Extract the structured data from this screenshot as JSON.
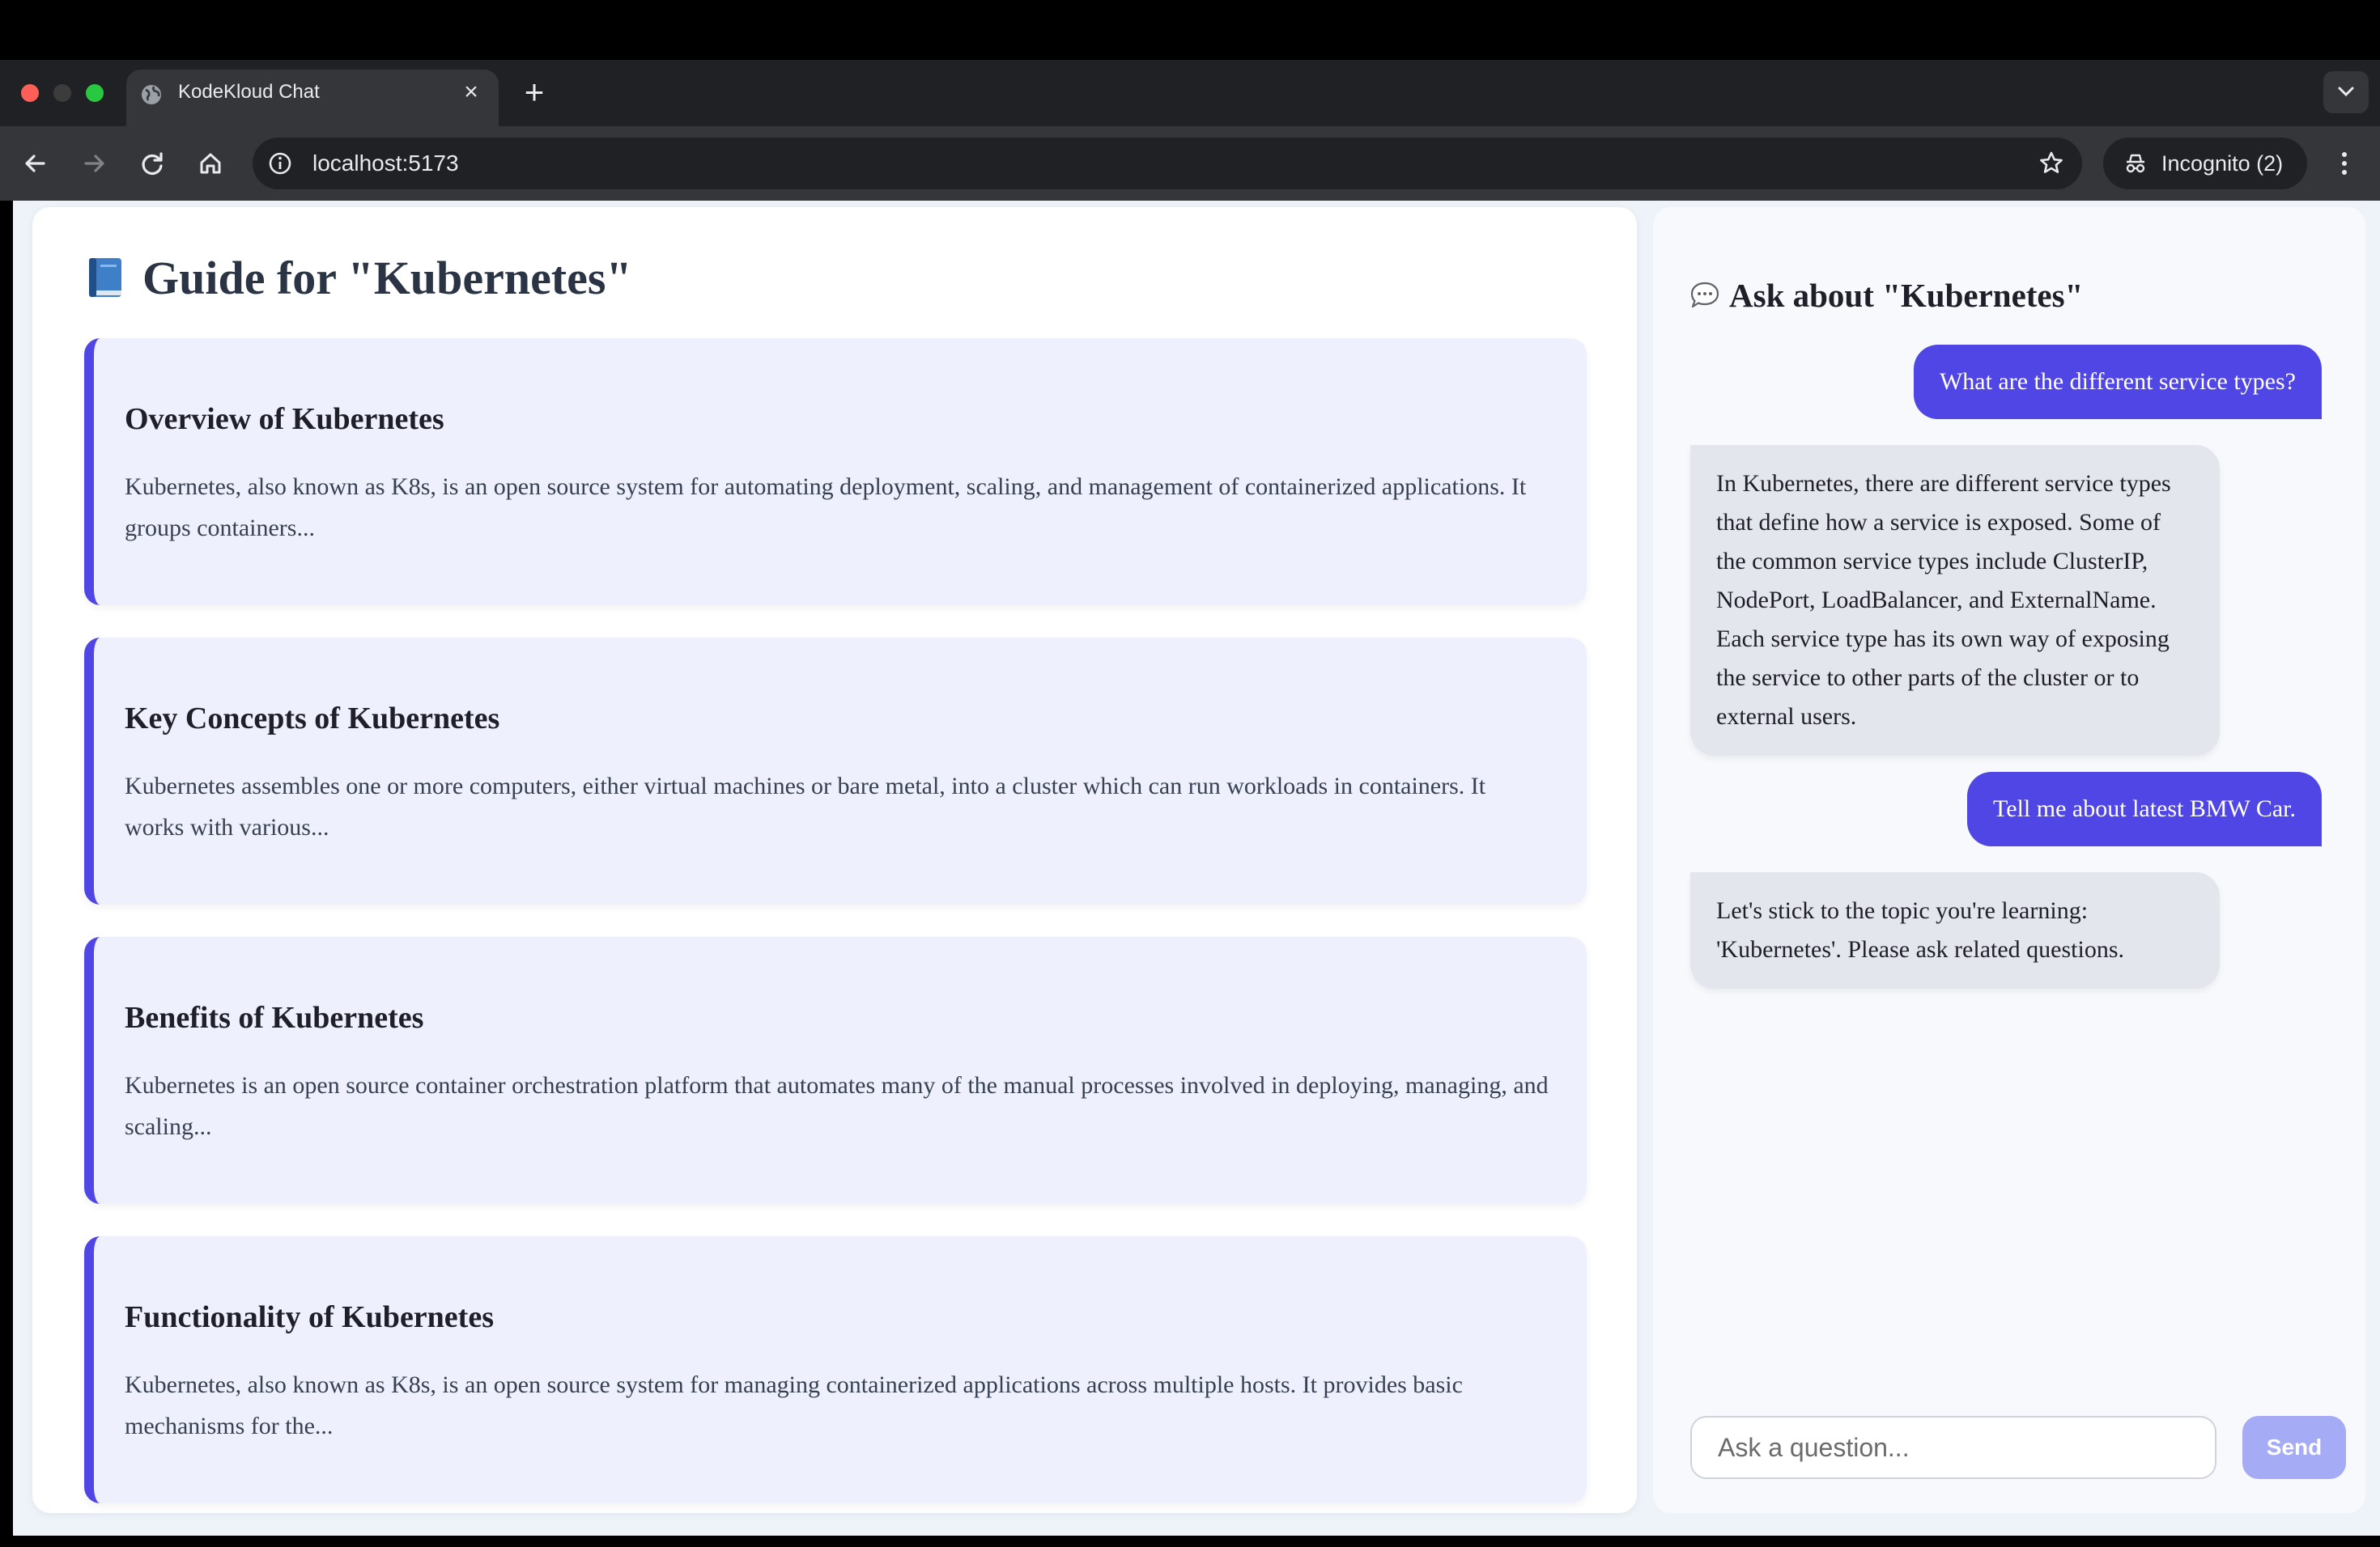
{
  "browser": {
    "tab_title": "KodeKloud Chat",
    "new_tab_symbol": "+",
    "close_symbol": "×",
    "url": "localhost:5173",
    "profile_label": "Incognito (2)"
  },
  "guide": {
    "title": "Guide for \"Kubernetes\"",
    "sections": [
      {
        "title": "Overview of Kubernetes",
        "summary": "Kubernetes, also known as K8s, is an open source system for automating deployment, scaling, and management of containerized applications. It groups containers..."
      },
      {
        "title": "Key Concepts of Kubernetes",
        "summary": "Kubernetes assembles one or more computers, either virtual machines or bare metal, into a cluster which can run workloads in containers. It works with various..."
      },
      {
        "title": "Benefits of Kubernetes",
        "summary": "Kubernetes is an open source container orchestration platform that automates many of the manual processes involved in deploying, managing, and scaling..."
      },
      {
        "title": "Functionality of Kubernetes",
        "summary": "Kubernetes, also known as K8s, is an open source system for managing containerized applications across multiple hosts. It provides basic mechanisms for the..."
      }
    ]
  },
  "chat": {
    "title": "Ask about \"Kubernetes\"",
    "messages": [
      {
        "role": "user",
        "text": "What are the different service types?"
      },
      {
        "role": "assistant",
        "text": "In Kubernetes, there are different service types that define how a service is exposed. Some of the common service types include ClusterIP, NodePort, LoadBalancer, and ExternalName. Each service type has its own way of exposing the service to other parts of the cluster or to external users."
      },
      {
        "role": "user",
        "text": "Tell me about latest BMW Car."
      },
      {
        "role": "assistant",
        "text": "Let's stick to the topic you're learning: 'Kubernetes'. Please ask related questions."
      }
    ],
    "input_placeholder": "Ask a question...",
    "input_value": "",
    "send_label": "Send"
  },
  "colors": {
    "accent": "#4f46e5",
    "send_disabled": "#a5abf5",
    "card_background": "#eff0fd",
    "assistant_bubble": "#e3e6ec"
  },
  "icons": {
    "tab": "globe-icon",
    "guide_title": "blue-book-icon",
    "chat_title": "speech-bubble-icon"
  }
}
